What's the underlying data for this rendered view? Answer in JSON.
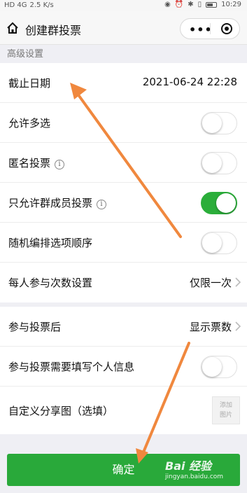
{
  "status_bar": {
    "network": "HD 4G",
    "speed": "2.5 K/s",
    "time": "10:29"
  },
  "header": {
    "title": "创建群投票",
    "more_icon": "more-dots-icon",
    "close_icon": "mini-program-close-icon"
  },
  "section_label": "高级设置",
  "group1": {
    "deadline_label": "截止日期",
    "deadline_value": "2021-06-24  22:28",
    "multi_select_label": "允许多选",
    "multi_select_on": false,
    "anonymous_label": "匿名投票",
    "anonymous_on": false,
    "members_only_label": "只允许群成员投票",
    "members_only_on": true,
    "random_order_label": "随机编排选项顺序",
    "random_order_on": false,
    "times_label": "每人参与次数设置",
    "times_value": "仅限一次"
  },
  "group2": {
    "after_vote_label": "参与投票后",
    "after_vote_value": "显示票数",
    "personal_info_label": "参与投票需要填写个人信息",
    "personal_info_on": false,
    "share_image_label": "自定义分享图（选填）",
    "add_image_label": "添加图片"
  },
  "confirm_label": "确定",
  "watermark": {
    "main": "Bai 经验",
    "sub": "jingyan.baidu.com"
  },
  "colors": {
    "toggle_on": "#2bae3a",
    "button": "#29a93a",
    "arrow": "#f0883e"
  }
}
